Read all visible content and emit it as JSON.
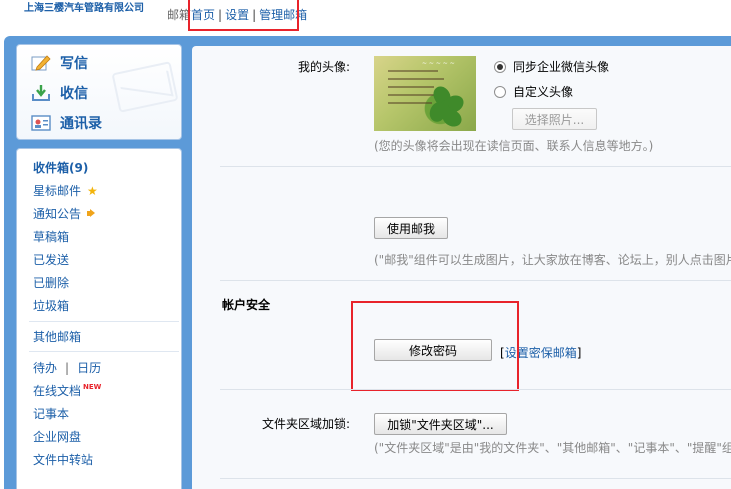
{
  "header": {
    "company": "上海三樱汽车管路有限公司",
    "links": {
      "prefix": "邮箱",
      "home": "首页",
      "settings": "设置",
      "manage": "管理邮箱"
    }
  },
  "quick_actions": {
    "compose": "写信",
    "inbox": "收信",
    "contacts": "通讯录"
  },
  "folders": {
    "inbox": "收件箱(9)",
    "starred": "星标邮件",
    "notice": "通知公告",
    "drafts": "草稿箱",
    "sent": "已发送",
    "deleted": "已删除",
    "spam": "垃圾箱",
    "other_mailbox": "其他邮箱",
    "todo": "待办",
    "calendar": "日历",
    "online_docs": "在线文档",
    "new_badge": "NEW",
    "notes": "记事本",
    "netdisk": "企业网盘",
    "transfer": "文件中转站"
  },
  "settings": {
    "avatar_label": "我的头像:",
    "avatar_option_sync": "同步企业微信头像",
    "avatar_option_custom": "自定义头像",
    "avatar_selected": "sync",
    "choose_photo": "选择照片...",
    "avatar_hint": "(您的头像将会出现在读信页面、联系人信息等地方。)",
    "use_mailme": "使用邮我",
    "mailme_hint": "(\"邮我\"组件可以生成图片，让大家放在博客、论坛上，别人点击图片",
    "account_security": "帐户安全",
    "change_password": "修改密码",
    "set_security_email": "设置密保邮箱",
    "folder_lock_label": "文件夹区域加锁:",
    "folder_lock_button": "加锁\"文件夹区域\"...",
    "folder_lock_hint": "(\"文件夹区域\"是由\"我的文件夹\"、\"其他邮箱\"、\"记事本\"、\"提醒\"组成"
  },
  "colors": {
    "accent": "#1c5fa8",
    "frame": "#5c9ad8",
    "highlight": "#e8232b"
  }
}
